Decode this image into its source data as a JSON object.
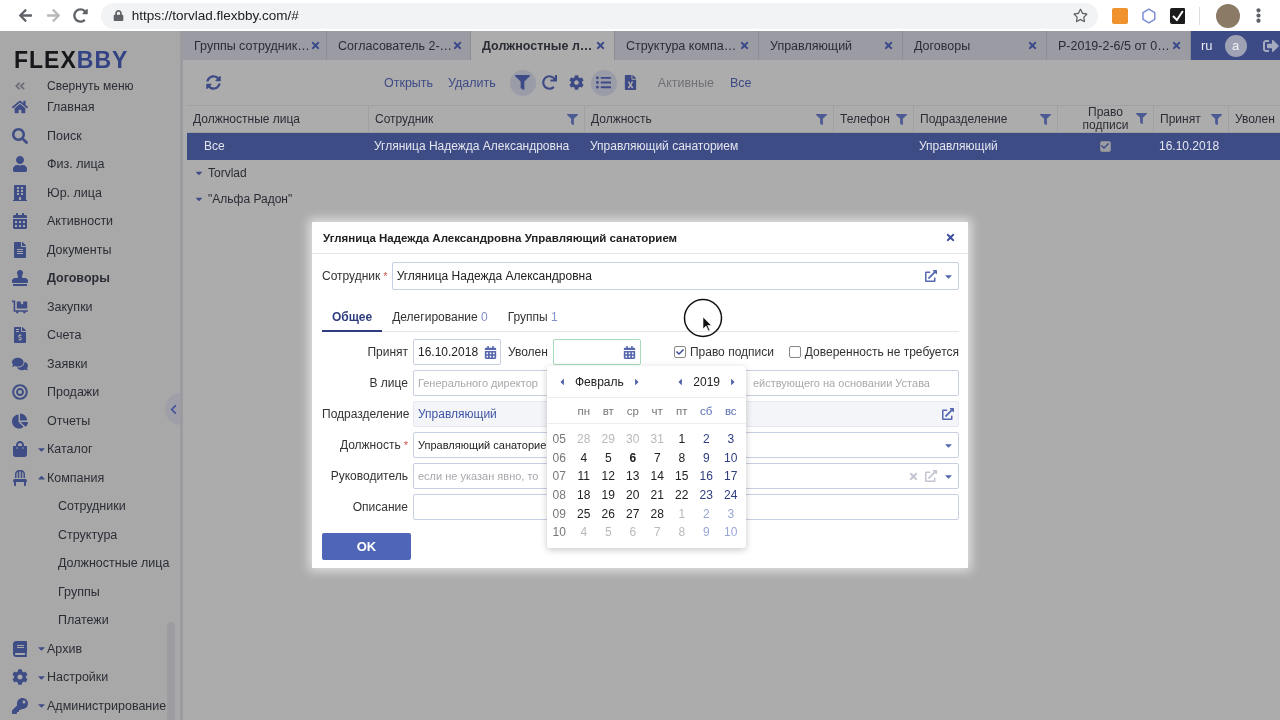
{
  "browser": {
    "url": "https://torvlad.flexbby.com/#"
  },
  "sidebar": {
    "logo": {
      "dark": "FLEX",
      "accent": "BBY"
    },
    "collapse_label": "Свернуть меню",
    "items": [
      {
        "label": "Главная",
        "selected": false
      },
      {
        "label": "Поиск",
        "selected": false
      },
      {
        "label": "Физ. лица",
        "selected": false
      },
      {
        "label": "Юр. лица",
        "selected": false
      },
      {
        "label": "Активности",
        "selected": false
      },
      {
        "label": "Документы",
        "selected": false
      },
      {
        "label": "Договоры",
        "selected": true
      },
      {
        "label": "Закупки",
        "selected": false
      },
      {
        "label": "Счета",
        "selected": false
      },
      {
        "label": "Заявки",
        "selected": false
      },
      {
        "label": "Продажи",
        "selected": false
      },
      {
        "label": "Отчеты",
        "selected": false
      },
      {
        "label": "Каталог",
        "selected": false,
        "expanded": false
      },
      {
        "label": "Компания",
        "selected": false,
        "expanded": true,
        "children": [
          {
            "label": "Сотрудники",
            "selected": false
          },
          {
            "label": "Структура",
            "selected": false
          },
          {
            "label": "Должностные лица",
            "selected": false
          },
          {
            "label": "Группы",
            "selected": false
          },
          {
            "label": "Платежи",
            "selected": false
          }
        ]
      },
      {
        "label": "Архив",
        "selected": false,
        "expanded": false
      },
      {
        "label": "Настройки",
        "selected": false,
        "expanded": false
      },
      {
        "label": "Администрирование",
        "selected": false,
        "expanded": false
      }
    ]
  },
  "tabs": [
    {
      "label": "Группы сотрудник…",
      "selected": false
    },
    {
      "label": "Согласователь 2-…",
      "selected": false
    },
    {
      "label": "Должностные л…",
      "selected": true
    },
    {
      "label": "Структура компа…",
      "selected": false
    },
    {
      "label": "Управляющий",
      "selected": false
    },
    {
      "label": "Договоры",
      "selected": false
    },
    {
      "label": "Р-2019-2-6/5 от 0…",
      "selected": false
    }
  ],
  "header": {
    "lang": "ru",
    "user_initial": "a"
  },
  "toolbar": {
    "actions": [
      "Открыть",
      "Удалить"
    ],
    "tools": [
      {
        "active": true
      },
      {
        "active": false
      },
      {
        "active": false
      },
      {
        "active": true
      },
      {
        "active": false
      }
    ],
    "filters": [
      {
        "label": "Активные",
        "selected": false
      },
      {
        "label": "Все",
        "selected": true
      }
    ]
  },
  "tree": {
    "header": "Должностные лица",
    "items": [
      {
        "label": "Все",
        "selected": true
      },
      {
        "label": "Torvlad",
        "selected": false,
        "expanded": false
      },
      {
        "label": "\"Альфа Радон\"",
        "selected": false,
        "expanded": false
      }
    ]
  },
  "table": {
    "columns": [
      {
        "label": "Сотрудник",
        "filter": true
      },
      {
        "label": "Должность",
        "filter": true
      },
      {
        "label": "Телефон",
        "filter": true
      },
      {
        "label": "Подразделение",
        "filter": true
      },
      {
        "label": "Право подписи",
        "filter": true
      },
      {
        "label": "Принят",
        "filter": true
      },
      {
        "label": "Уволен"
      }
    ],
    "rows": [
      {
        "selected": true,
        "employee": "Угляница Надежда Александровна",
        "position": "Управляющий санаторием",
        "department": "Управляющий",
        "signing": true,
        "hired": "16.10.2018"
      }
    ]
  },
  "dialog": {
    "title": "Угляница Надежда Александровна Управляющий санаторием",
    "employee": {
      "label": "Сотрудник",
      "required_mark": "*",
      "value": "Угляница Надежда Александровна"
    },
    "tabs": [
      {
        "label": "Общее",
        "selected": true
      },
      {
        "label": "Делегирование",
        "count": "0",
        "selected": false
      },
      {
        "label": "Группы",
        "count": "1",
        "selected": false
      }
    ],
    "hired": {
      "label": "Принят",
      "value": "16.10.2018"
    },
    "fired": {
      "label": "Уволен",
      "focused": true
    },
    "checks": [
      {
        "label": "Право подписи",
        "checked": true
      },
      {
        "label": "Доверенность не требуется",
        "checked": false
      }
    ],
    "fields": [
      {
        "kind": "text",
        "label": "В лице",
        "placeholder": "Генерального директор",
        "placeholder_tail": "ействующего на основании Устава"
      },
      {
        "kind": "link",
        "label": "Подразделение",
        "value": "Управляющий"
      },
      {
        "kind": "select",
        "label": "Должность",
        "required_mark": "*",
        "value": "Управляющий санаторие"
      },
      {
        "kind": "lookup",
        "label": "Руководитель",
        "placeholder": "если не указан явно, то"
      },
      {
        "kind": "text",
        "label": "Описание"
      }
    ],
    "ok": "OK",
    "calendar": {
      "month": "Февраль",
      "year": "2019",
      "weekdays": [
        "пн",
        "вт",
        "ср",
        "чт",
        "пт",
        "сб",
        "вс"
      ],
      "weeks": [
        {
          "number": "05",
          "days": [
            {
              "d": "28",
              "out": true,
              "today": false
            },
            {
              "d": "29",
              "out": true,
              "today": false
            },
            {
              "d": "30",
              "out": true,
              "today": false
            },
            {
              "d": "31",
              "out": true,
              "today": false
            },
            {
              "d": "1",
              "out": false,
              "today": false
            },
            {
              "d": "2",
              "out": false,
              "today": false
            },
            {
              "d": "3",
              "out": false,
              "today": false
            }
          ]
        },
        {
          "number": "06",
          "days": [
            {
              "d": "4",
              "out": false,
              "today": false
            },
            {
              "d": "5",
              "out": false,
              "today": false
            },
            {
              "d": "6",
              "out": false,
              "today": true
            },
            {
              "d": "7",
              "out": false,
              "today": false
            },
            {
              "d": "8",
              "out": false,
              "today": false
            },
            {
              "d": "9",
              "out": false,
              "today": false
            },
            {
              "d": "10",
              "out": false,
              "today": false
            }
          ]
        },
        {
          "number": "07",
          "days": [
            {
              "d": "11",
              "out": false,
              "today": false
            },
            {
              "d": "12",
              "out": false,
              "today": false
            },
            {
              "d": "13",
              "out": false,
              "today": false
            },
            {
              "d": "14",
              "out": false,
              "today": false
            },
            {
              "d": "15",
              "out": false,
              "today": false
            },
            {
              "d": "16",
              "out": false,
              "today": false
            },
            {
              "d": "17",
              "out": false,
              "today": false
            }
          ]
        },
        {
          "number": "08",
          "days": [
            {
              "d": "18",
              "out": false,
              "today": false
            },
            {
              "d": "19",
              "out": false,
              "today": false
            },
            {
              "d": "20",
              "out": false,
              "today": false
            },
            {
              "d": "21",
              "out": false,
              "today": false
            },
            {
              "d": "22",
              "out": false,
              "today": false
            },
            {
              "d": "23",
              "out": false,
              "today": false
            },
            {
              "d": "24",
              "out": false,
              "today": false
            }
          ]
        },
        {
          "number": "09",
          "days": [
            {
              "d": "25",
              "out": false,
              "today": false
            },
            {
              "d": "26",
              "out": false,
              "today": false
            },
            {
              "d": "27",
              "out": false,
              "today": false
            },
            {
              "d": "28",
              "out": false,
              "today": false
            },
            {
              "d": "1",
              "out": true,
              "today": false
            },
            {
              "d": "2",
              "out": true,
              "today": false
            },
            {
              "d": "3",
              "out": true,
              "today": false
            }
          ]
        },
        {
          "number": "10",
          "days": [
            {
              "d": "4",
              "out": true,
              "today": false
            },
            {
              "d": "5",
              "out": true,
              "today": false
            },
            {
              "d": "6",
              "out": true,
              "today": false
            },
            {
              "d": "7",
              "out": true,
              "today": false
            },
            {
              "d": "8",
              "out": true,
              "today": false
            },
            {
              "d": "9",
              "out": true,
              "today": false
            },
            {
              "d": "10",
              "out": true,
              "today": false
            }
          ]
        }
      ]
    }
  }
}
